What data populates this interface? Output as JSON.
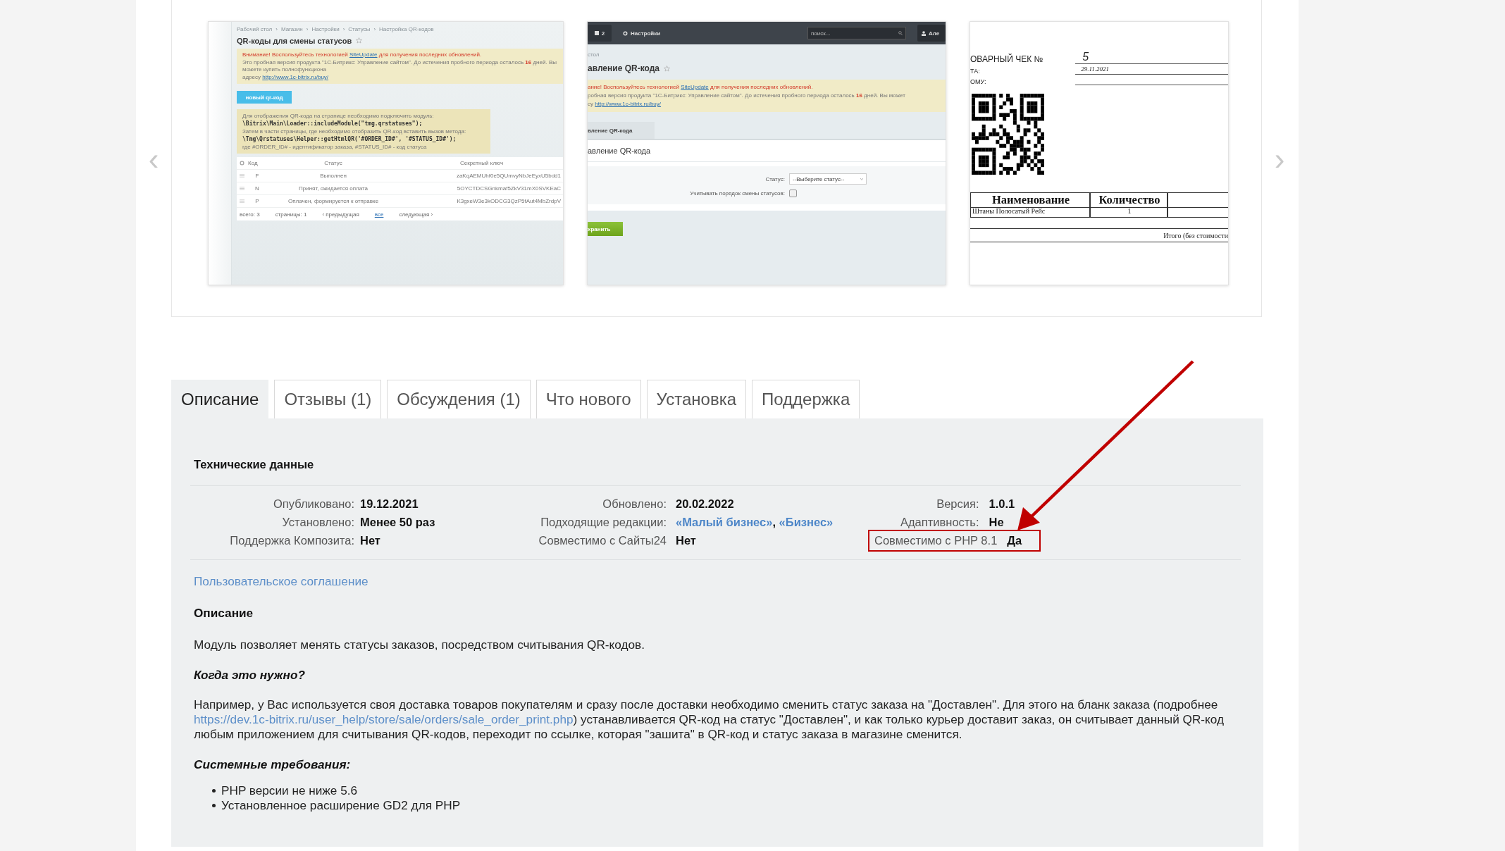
{
  "gallery": {
    "prev": "‹",
    "next": "›",
    "slides": [
      {
        "kind": "admin_list",
        "breadcrumbs": [
          "Рабочий стол",
          "Магазин",
          "Настройки",
          "Статусы",
          "Настройка QR-кодов"
        ],
        "separator": "›",
        "title": "QR-коды для смены статусов",
        "notice": [
          {
            "kind": "warning",
            "parts": [
              {
                "kind": "text",
                "text": "Внимание! Воспользуйтесь технологией "
              },
              {
                "kind": "link",
                "text": "SiteUpdate"
              },
              {
                "kind": "text",
                "text": " для получения последних обновлений."
              }
            ]
          },
          {
            "kind": "text",
            "parts": [
              {
                "kind": "text",
                "text": "Это пробная версия продукта \"1С-Битрикс: Управление сайтом\". До истечения пробного периода осталось "
              },
              {
                "kind": "strong",
                "text": "16"
              },
              {
                "kind": "text",
                "text": " дней. Вы можете купить полнофункциона"
              }
            ]
          },
          {
            "kind": "text",
            "parts": [
              {
                "kind": "text",
                "text": "адресу "
              },
              {
                "kind": "link",
                "text": "http://www.1c-bitrix.ru/buy/"
              }
            ]
          }
        ],
        "button": "новый qr-код",
        "info": [
          {
            "kind": "text",
            "text": "Для отображения QR-кода на странице необходимо подключить модуль:"
          },
          {
            "kind": "code",
            "text": "\\Bitrix\\Main\\Loader::includeModule(\"tmg.qrstatuses\");"
          },
          {
            "kind": "text",
            "text": "Затем в части страницы, где необходимо отобразить QR-код вставить вызов метода:"
          },
          {
            "kind": "code",
            "text": "\\Tmg\\Qrstatuses\\Helper::getHtmlQR('#ORDER_ID#', '#STATUS_ID#');"
          },
          {
            "kind": "text",
            "text": "где #ORDER_ID# - идентификатор заказа, #STATUS_ID# - код статуса"
          }
        ],
        "columns": [
          "Код",
          "Статус",
          "Секретный ключ"
        ],
        "rows": [
          [
            "F",
            "Выполнен",
            "zaKqAEMUhf0e5QUmvyNbJeEyxU5bdd1"
          ],
          [
            "N",
            "Принят, ожидается оплата",
            "5OYCTDCSGnkmaf5ZkV31mX0SVKEaC"
          ],
          [
            "P",
            "Оплачен, формируется к отправке",
            "K3gxeW3e3kODCG3QzP5fAut4MbZrdpV"
          ]
        ],
        "footer": [
          {
            "kind": "text",
            "text": "всего: 3"
          },
          {
            "kind": "text",
            "text": "страницы: 1"
          },
          {
            "kind": "link",
            "text": "‹ предыдущая"
          },
          {
            "kind": "current",
            "text": "все"
          },
          {
            "kind": "link",
            "text": "следующая ›"
          }
        ]
      },
      {
        "kind": "admin_form",
        "badge": "2",
        "settings": "Настройки",
        "search_placeholder": "поиск...",
        "user": "Але",
        "breadcrumb": "стол",
        "title": "авление QR-кода",
        "notice": [
          {
            "kind": "warning",
            "parts": [
              {
                "kind": "text",
                "text": "ание! Воспользуйтесь технологией "
              },
              {
                "kind": "link",
                "text": "SiteUpdate"
              },
              {
                "kind": "text",
                "text": " для получения последних обновлений."
              }
            ]
          },
          {
            "kind": "text",
            "parts": [
              {
                "kind": "text",
                "text": "робная версия продукта \"1С-Битрикс: Управление сайтом\". До истечения пробного периода осталось "
              },
              {
                "kind": "strong",
                "text": "16"
              },
              {
                "kind": "text",
                "text": " дней. Вы может"
              }
            ]
          },
          {
            "kind": "text",
            "parts": [
              {
                "kind": "text",
                "text": "су "
              },
              {
                "kind": "link",
                "text": "http://www.1c-bitrix.ru/buy/"
              }
            ]
          }
        ],
        "tab": "вление QR-кода",
        "form_title": "авление QR-кода",
        "fields": [
          {
            "kind": "select",
            "label": "Статус:",
            "value": "--Выберите статус--"
          },
          {
            "kind": "checkbox",
            "label": "Учитывать порядок смены статусов:",
            "checked": false
          }
        ],
        "save": "хранить"
      },
      {
        "kind": "receipt",
        "title": "ОВАРНЫЙ ЧЕК №",
        "number": "5",
        "lines": [
          {
            "label": "ТА:",
            "value": "29.11.2021"
          },
          {
            "label": "ОМУ:"
          }
        ],
        "columns": [
          "Наименование",
          "Количество"
        ],
        "rows": [
          [
            "Штаны Полосатый Рейс",
            "1"
          ]
        ],
        "total": "Итого (без стоимости"
      }
    ]
  },
  "tabs": [
    {
      "label": "Описание",
      "selected": true
    },
    {
      "label": "Отзывы (1)",
      "selected": false
    },
    {
      "label": "Обсуждения (1)",
      "selected": false
    },
    {
      "label": "Что нового",
      "selected": false
    },
    {
      "label": "Установка",
      "selected": false
    },
    {
      "label": "Поддержка",
      "selected": false
    }
  ],
  "tech": {
    "title": "Технические данные",
    "columns": [
      [
        {
          "label": "Опубликовано:",
          "value": "19.12.2021",
          "highlighted": false
        },
        {
          "label": "Установлено:",
          "value": "Менее 50 раз",
          "highlighted": false
        },
        {
          "label": "Поддержка Композита:",
          "value": "Нет",
          "highlighted": false
        }
      ],
      [
        {
          "label": "Обновлено:",
          "value": "20.02.2022",
          "highlighted": false
        },
        {
          "label": "Подходящие редакции:",
          "parts": [
            {
              "kind": "link",
              "text": "«Малый бизнес»"
            },
            {
              "kind": "text",
              "text": ", "
            },
            {
              "kind": "link",
              "text": "«Бизнес»"
            }
          ],
          "highlighted": false
        },
        {
          "label": "Совместимо с Сайты24",
          "value": "Нет",
          "highlighted": false
        }
      ],
      [
        {
          "label": "Версия:",
          "value": "1.0.1",
          "highlighted": false
        },
        {
          "label": "Адаптивность:",
          "value": "Не",
          "highlighted": false
        },
        {
          "label": "Совместимо с PHP 8.1",
          "value": "Да",
          "highlighted": true
        }
      ]
    ]
  },
  "agreement_link": "Пользовательское соглашение",
  "description": {
    "title": "Описание",
    "blocks": [
      {
        "kind": "paragraph",
        "parts": [
          {
            "kind": "text",
            "text": "Модуль позволяет менять статусы заказов, посредством считывания QR-кодов."
          }
        ]
      },
      {
        "kind": "subheading",
        "text": "Когда это нужно?"
      },
      {
        "kind": "paragraph",
        "parts": [
          {
            "kind": "text",
            "text": "Например, у Вас используется своя доставка товаров покупателям и сразу после доставки необходимо сменить статус заказа на \"Доставлен\". Для этого на бланк заказа (подробнее "
          },
          {
            "kind": "link",
            "text": "https://dev.1c-bitrix.ru/user_help/store/sale/orders/sale_order_print.php"
          },
          {
            "kind": "text",
            "text": ") устанавливается QR-код на статус \"Доставлен\", и как только курьер доставит заказ, он считывает данный QR-код любым приложением для считывания QR-кодов, переходит по ссылке, которая \"зашита\" в QR-код и статус заказа в магазине сменится."
          }
        ]
      },
      {
        "kind": "subheading",
        "text": "Системные требования:"
      },
      {
        "kind": "list",
        "items": [
          "PHP версии не ниже 5.6",
          "Установленное расширение GD2 для PHP"
        ]
      }
    ]
  }
}
